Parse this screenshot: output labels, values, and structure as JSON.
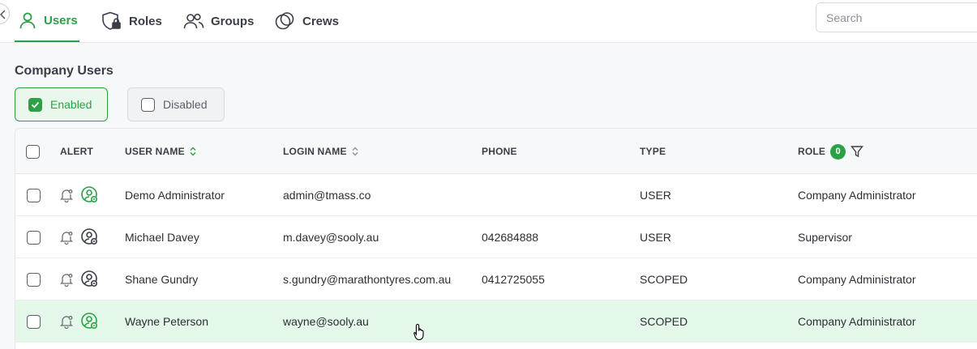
{
  "nav": {
    "tabs": [
      {
        "label": "Users",
        "icon": "user-icon"
      },
      {
        "label": "Roles",
        "icon": "shield-lock-icon"
      },
      {
        "label": "Groups",
        "icon": "users-icon"
      },
      {
        "label": "Crews",
        "icon": "circles-icon"
      }
    ],
    "search_placeholder": "Search",
    "accent_color": "#2aa147"
  },
  "section_title": "Company Users",
  "filters": {
    "enabled_label": "Enabled",
    "disabled_label": "Disabled"
  },
  "table": {
    "columns": {
      "alert": "ALERT",
      "user_name": "USER NAME",
      "login_name": "LOGIN NAME",
      "phone": "PHONE",
      "type": "TYPE",
      "role": "ROLE"
    },
    "role_filter_count": "0",
    "rows": [
      {
        "user_name": "Demo Administrator",
        "login_name": "admin@tmass.co",
        "phone": "",
        "type": "USER",
        "role": "Company Administrator",
        "status_color": "#2aa147"
      },
      {
        "user_name": "Michael Davey",
        "login_name": "m.davey@sooly.au",
        "phone": "042684888",
        "type": "USER",
        "role": "Supervisor",
        "status_color": "#3a3f47"
      },
      {
        "user_name": "Shane Gundry",
        "login_name": "s.gundry@marathontyres.com.au",
        "phone": "0412725055",
        "type": "SCOPED",
        "role": "Company Administrator",
        "status_color": "#3a3f47"
      },
      {
        "user_name": "Wayne Peterson",
        "login_name": "wayne@sooly.au",
        "phone": "",
        "type": "SCOPED",
        "role": "Company Administrator",
        "status_color": "#2aa147"
      }
    ]
  }
}
